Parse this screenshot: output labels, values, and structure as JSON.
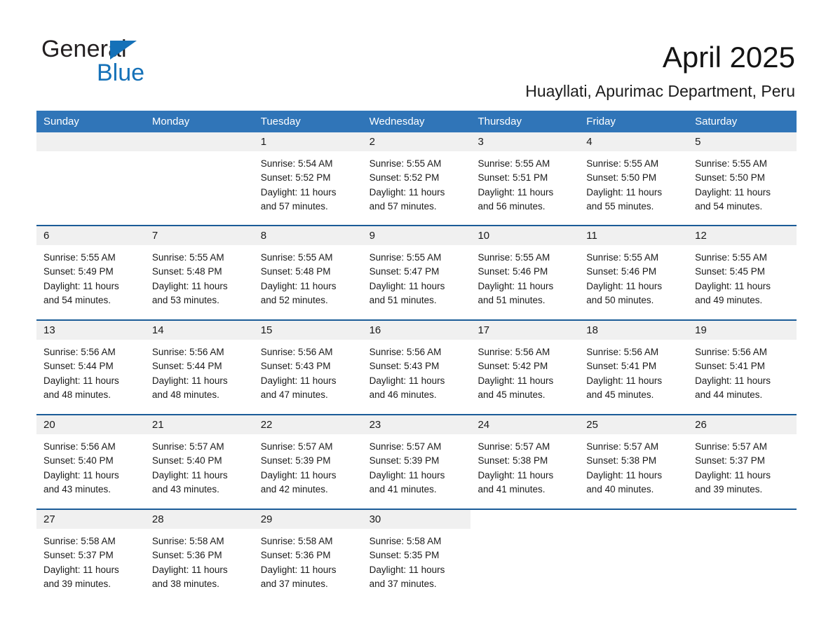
{
  "brand": {
    "name_part1": "General",
    "name_part2": "Blue",
    "triangle_color": "#1571b8",
    "text_color": "#231f20"
  },
  "header": {
    "month_title": "April 2025",
    "location": "Huayllati, Apurimac Department, Peru"
  },
  "theme": {
    "header_blue": "#3075b8",
    "row_border_blue": "#1b5c98",
    "day_number_bg": "#f0f0f0",
    "cell_bg": "#ffffff",
    "text_color": "#1a1a1a"
  },
  "calendar": {
    "weekday_headers": [
      "Sunday",
      "Monday",
      "Tuesday",
      "Wednesday",
      "Thursday",
      "Friday",
      "Saturday"
    ],
    "labels": {
      "sunrise": "Sunrise:",
      "sunset": "Sunset:",
      "daylight": "Daylight:"
    },
    "weeks": [
      [
        {
          "day": "",
          "sunrise": "",
          "sunset": "",
          "daylight_line1": "",
          "daylight_line2": "",
          "empty": true
        },
        {
          "day": "",
          "sunrise": "",
          "sunset": "",
          "daylight_line1": "",
          "daylight_line2": "",
          "empty": true
        },
        {
          "day": "1",
          "sunrise": "Sunrise: 5:54 AM",
          "sunset": "Sunset: 5:52 PM",
          "daylight_line1": "Daylight: 11 hours",
          "daylight_line2": "and 57 minutes."
        },
        {
          "day": "2",
          "sunrise": "Sunrise: 5:55 AM",
          "sunset": "Sunset: 5:52 PM",
          "daylight_line1": "Daylight: 11 hours",
          "daylight_line2": "and 57 minutes."
        },
        {
          "day": "3",
          "sunrise": "Sunrise: 5:55 AM",
          "sunset": "Sunset: 5:51 PM",
          "daylight_line1": "Daylight: 11 hours",
          "daylight_line2": "and 56 minutes."
        },
        {
          "day": "4",
          "sunrise": "Sunrise: 5:55 AM",
          "sunset": "Sunset: 5:50 PM",
          "daylight_line1": "Daylight: 11 hours",
          "daylight_line2": "and 55 minutes."
        },
        {
          "day": "5",
          "sunrise": "Sunrise: 5:55 AM",
          "sunset": "Sunset: 5:50 PM",
          "daylight_line1": "Daylight: 11 hours",
          "daylight_line2": "and 54 minutes."
        }
      ],
      [
        {
          "day": "6",
          "sunrise": "Sunrise: 5:55 AM",
          "sunset": "Sunset: 5:49 PM",
          "daylight_line1": "Daylight: 11 hours",
          "daylight_line2": "and 54 minutes."
        },
        {
          "day": "7",
          "sunrise": "Sunrise: 5:55 AM",
          "sunset": "Sunset: 5:48 PM",
          "daylight_line1": "Daylight: 11 hours",
          "daylight_line2": "and 53 minutes."
        },
        {
          "day": "8",
          "sunrise": "Sunrise: 5:55 AM",
          "sunset": "Sunset: 5:48 PM",
          "daylight_line1": "Daylight: 11 hours",
          "daylight_line2": "and 52 minutes."
        },
        {
          "day": "9",
          "sunrise": "Sunrise: 5:55 AM",
          "sunset": "Sunset: 5:47 PM",
          "daylight_line1": "Daylight: 11 hours",
          "daylight_line2": "and 51 minutes."
        },
        {
          "day": "10",
          "sunrise": "Sunrise: 5:55 AM",
          "sunset": "Sunset: 5:46 PM",
          "daylight_line1": "Daylight: 11 hours",
          "daylight_line2": "and 51 minutes."
        },
        {
          "day": "11",
          "sunrise": "Sunrise: 5:55 AM",
          "sunset": "Sunset: 5:46 PM",
          "daylight_line1": "Daylight: 11 hours",
          "daylight_line2": "and 50 minutes."
        },
        {
          "day": "12",
          "sunrise": "Sunrise: 5:55 AM",
          "sunset": "Sunset: 5:45 PM",
          "daylight_line1": "Daylight: 11 hours",
          "daylight_line2": "and 49 minutes."
        }
      ],
      [
        {
          "day": "13",
          "sunrise": "Sunrise: 5:56 AM",
          "sunset": "Sunset: 5:44 PM",
          "daylight_line1": "Daylight: 11 hours",
          "daylight_line2": "and 48 minutes."
        },
        {
          "day": "14",
          "sunrise": "Sunrise: 5:56 AM",
          "sunset": "Sunset: 5:44 PM",
          "daylight_line1": "Daylight: 11 hours",
          "daylight_line2": "and 48 minutes."
        },
        {
          "day": "15",
          "sunrise": "Sunrise: 5:56 AM",
          "sunset": "Sunset: 5:43 PM",
          "daylight_line1": "Daylight: 11 hours",
          "daylight_line2": "and 47 minutes."
        },
        {
          "day": "16",
          "sunrise": "Sunrise: 5:56 AM",
          "sunset": "Sunset: 5:43 PM",
          "daylight_line1": "Daylight: 11 hours",
          "daylight_line2": "and 46 minutes."
        },
        {
          "day": "17",
          "sunrise": "Sunrise: 5:56 AM",
          "sunset": "Sunset: 5:42 PM",
          "daylight_line1": "Daylight: 11 hours",
          "daylight_line2": "and 45 minutes."
        },
        {
          "day": "18",
          "sunrise": "Sunrise: 5:56 AM",
          "sunset": "Sunset: 5:41 PM",
          "daylight_line1": "Daylight: 11 hours",
          "daylight_line2": "and 45 minutes."
        },
        {
          "day": "19",
          "sunrise": "Sunrise: 5:56 AM",
          "sunset": "Sunset: 5:41 PM",
          "daylight_line1": "Daylight: 11 hours",
          "daylight_line2": "and 44 minutes."
        }
      ],
      [
        {
          "day": "20",
          "sunrise": "Sunrise: 5:56 AM",
          "sunset": "Sunset: 5:40 PM",
          "daylight_line1": "Daylight: 11 hours",
          "daylight_line2": "and 43 minutes."
        },
        {
          "day": "21",
          "sunrise": "Sunrise: 5:57 AM",
          "sunset": "Sunset: 5:40 PM",
          "daylight_line1": "Daylight: 11 hours",
          "daylight_line2": "and 43 minutes."
        },
        {
          "day": "22",
          "sunrise": "Sunrise: 5:57 AM",
          "sunset": "Sunset: 5:39 PM",
          "daylight_line1": "Daylight: 11 hours",
          "daylight_line2": "and 42 minutes."
        },
        {
          "day": "23",
          "sunrise": "Sunrise: 5:57 AM",
          "sunset": "Sunset: 5:39 PM",
          "daylight_line1": "Daylight: 11 hours",
          "daylight_line2": "and 41 minutes."
        },
        {
          "day": "24",
          "sunrise": "Sunrise: 5:57 AM",
          "sunset": "Sunset: 5:38 PM",
          "daylight_line1": "Daylight: 11 hours",
          "daylight_line2": "and 41 minutes."
        },
        {
          "day": "25",
          "sunrise": "Sunrise: 5:57 AM",
          "sunset": "Sunset: 5:38 PM",
          "daylight_line1": "Daylight: 11 hours",
          "daylight_line2": "and 40 minutes."
        },
        {
          "day": "26",
          "sunrise": "Sunrise: 5:57 AM",
          "sunset": "Sunset: 5:37 PM",
          "daylight_line1": "Daylight: 11 hours",
          "daylight_line2": "and 39 minutes."
        }
      ],
      [
        {
          "day": "27",
          "sunrise": "Sunrise: 5:58 AM",
          "sunset": "Sunset: 5:37 PM",
          "daylight_line1": "Daylight: 11 hours",
          "daylight_line2": "and 39 minutes."
        },
        {
          "day": "28",
          "sunrise": "Sunrise: 5:58 AM",
          "sunset": "Sunset: 5:36 PM",
          "daylight_line1": "Daylight: 11 hours",
          "daylight_line2": "and 38 minutes."
        },
        {
          "day": "29",
          "sunrise": "Sunrise: 5:58 AM",
          "sunset": "Sunset: 5:36 PM",
          "daylight_line1": "Daylight: 11 hours",
          "daylight_line2": "and 37 minutes."
        },
        {
          "day": "30",
          "sunrise": "Sunrise: 5:58 AM",
          "sunset": "Sunset: 5:35 PM",
          "daylight_line1": "Daylight: 11 hours",
          "daylight_line2": "and 37 minutes."
        },
        {
          "day": null,
          "blank": true
        },
        {
          "day": null,
          "blank": true
        },
        {
          "day": null,
          "blank": true
        }
      ]
    ]
  }
}
